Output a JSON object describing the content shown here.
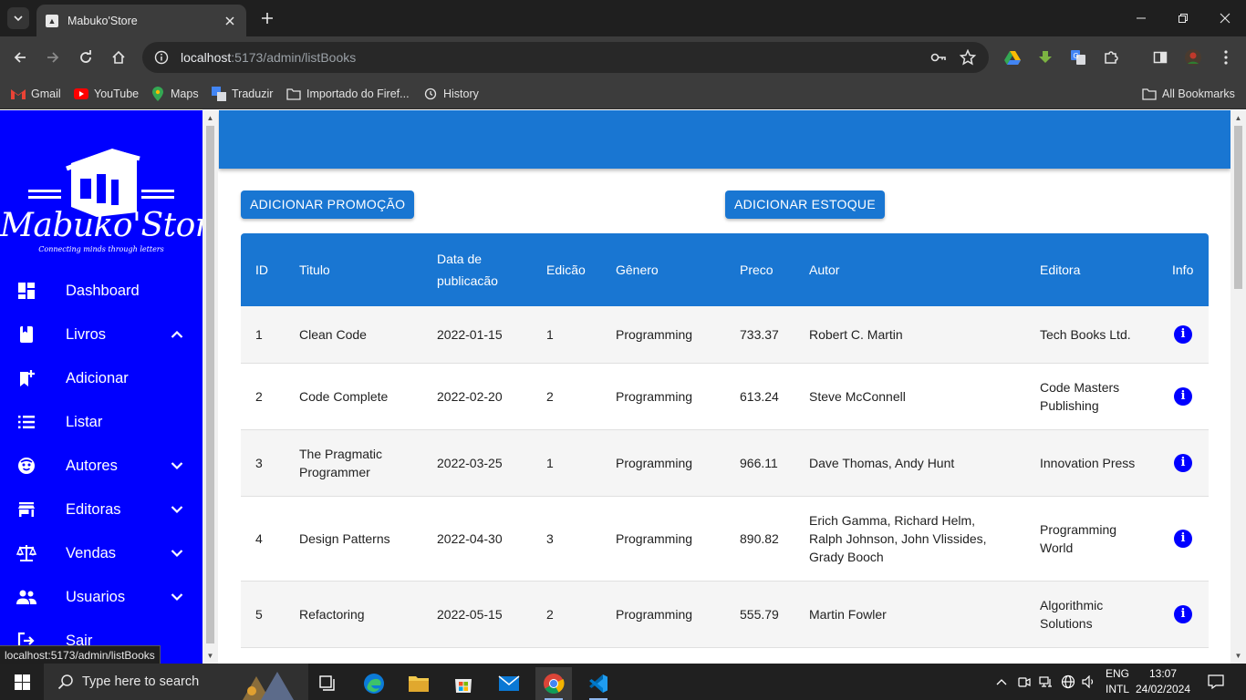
{
  "browser": {
    "tab_title": "Mabuko'Store",
    "url_host": "localhost",
    "url_path": ":5173/admin/listBooks",
    "status_url": "localhost:5173/admin/listBooks",
    "bookmarks": [
      "Gmail",
      "YouTube",
      "Maps",
      "Traduzir",
      "Importado do Firef...",
      "History"
    ],
    "all_bookmarks": "All Bookmarks"
  },
  "sidebar": {
    "brand": "Mabuko'Store",
    "tagline": "Connecting minds through letters",
    "items": [
      {
        "label": "Dashboard",
        "icon": "dashboard-icon",
        "chevron": ""
      },
      {
        "label": "Livros",
        "icon": "book-icon",
        "chevron": "up"
      },
      {
        "label": "Adicionar",
        "icon": "bookmark-add-icon",
        "chevron": ""
      },
      {
        "label": "Listar",
        "icon": "list-icon",
        "chevron": ""
      },
      {
        "label": "Autores",
        "icon": "face-icon",
        "chevron": "down"
      },
      {
        "label": "Editoras",
        "icon": "store-icon",
        "chevron": "down"
      },
      {
        "label": "Vendas",
        "icon": "scale-icon",
        "chevron": "down"
      },
      {
        "label": "Usuarios",
        "icon": "people-icon",
        "chevron": "down"
      },
      {
        "label": "Sair",
        "icon": "logout-icon",
        "chevron": ""
      }
    ]
  },
  "actions": {
    "add_promo": "ADICIONAR PROMOÇÃO",
    "add_stock": "ADICIONAR ESTOQUE"
  },
  "table": {
    "headers": {
      "id": "ID",
      "title": "Titulo",
      "date_line1": "Data de",
      "date_line2": "publicacão",
      "edition": "Edicão",
      "genre": "Gênero",
      "price": "Preco",
      "author": "Autor",
      "publisher": "Editora",
      "info": "Info"
    },
    "rows": [
      {
        "id": "1",
        "title": "Clean Code",
        "date": "2022-01-15",
        "edition": "1",
        "genre": "Programming",
        "price": "733.37",
        "author": "Robert C. Martin",
        "publisher": "Tech Books Ltd."
      },
      {
        "id": "2",
        "title": "Code Complete",
        "date": "2022-02-20",
        "edition": "2",
        "genre": "Programming",
        "price": "613.24",
        "author": "Steve McConnell",
        "publisher": "Code Masters Publishing"
      },
      {
        "id": "3",
        "title": "The Pragmatic Programmer",
        "date": "2022-03-25",
        "edition": "1",
        "genre": "Programming",
        "price": "966.11",
        "author": "Dave Thomas, Andy Hunt",
        "publisher": "Innovation Press"
      },
      {
        "id": "4",
        "title": "Design Patterns",
        "date": "2022-04-30",
        "edition": "3",
        "genre": "Programming",
        "price": "890.82",
        "author": "Erich Gamma, Richard Helm, Ralph Johnson, John Vlissides, Grady Booch",
        "publisher": "Programming World"
      },
      {
        "id": "5",
        "title": "Refactoring",
        "date": "2022-05-15",
        "edition": "2",
        "genre": "Programming",
        "price": "555.79",
        "author": "Martin Fowler",
        "publisher": "Algorithmic Solutions"
      }
    ]
  },
  "taskbar": {
    "search_placeholder": "Type here to search",
    "lang_line1": "ENG",
    "lang_line2": "INTL",
    "time": "13:07",
    "date": "24/02/2024"
  },
  "colors": {
    "sidebar": "#0000ff",
    "primary": "#1976d2",
    "info_icon": "#0000ff"
  }
}
